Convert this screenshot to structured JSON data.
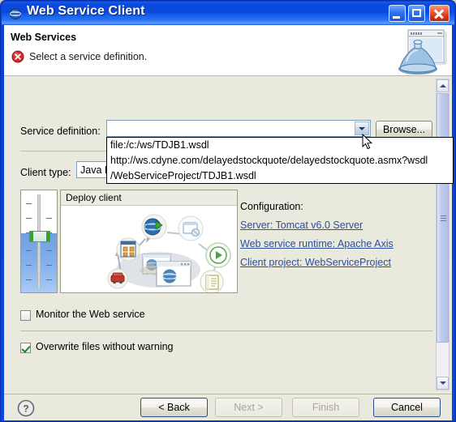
{
  "window": {
    "title": "Web Service Client",
    "icon": "globe-icon",
    "minimize_label": "Minimize",
    "maximize_label": "Maximize",
    "close_label": "Close"
  },
  "header": {
    "title": "Web Services",
    "message": "Select a service definition.",
    "error_icon": "error-circle-icon",
    "banner_icon": "web-service-banner-icon"
  },
  "form": {
    "service_definition_label": "Service definition:",
    "service_definition_value": "",
    "service_definition_placeholder": "",
    "browse_label": "Browse...",
    "dropdown_open": true,
    "dropdown_options": [
      "file:/c:/ws/TDJB1.wsdl",
      "http://ws.cdyne.com/delayedstockquote/delayedstockquote.asmx?wsdl",
      "/WebServiceProject/TDJB1.wsdl"
    ],
    "client_type_label": "Client type:",
    "client_type_value": "Java Proxy"
  },
  "diagram": {
    "title": "Deploy client",
    "slider_name": "service-generation-slider"
  },
  "configuration": {
    "label": "Configuration:",
    "links": [
      "Server: Tomcat v6.0 Server",
      "Web service runtime: Apache Axis",
      "Client project: WebServiceProject"
    ]
  },
  "options": [
    {
      "label": "Monitor the Web service",
      "checked": false
    },
    {
      "label": "Overwrite files without warning",
      "checked": true
    }
  ],
  "buttons": {
    "help_label": "?",
    "back_label": "< Back",
    "next_label": "Next >",
    "finish_label": "Finish",
    "cancel_label": "Cancel",
    "back_enabled": true,
    "next_enabled": false,
    "finish_enabled": false,
    "cancel_enabled": true
  },
  "scrollbar": {
    "up_label": "Scroll up",
    "down_label": "Scroll down"
  },
  "colors": {
    "titlebar_blue": "#0b49dd",
    "dialog_beige": "#e9e9dd",
    "link_blue": "#2b4fa0",
    "error_red": "#cc2222",
    "check_green": "#1a8a1a"
  }
}
